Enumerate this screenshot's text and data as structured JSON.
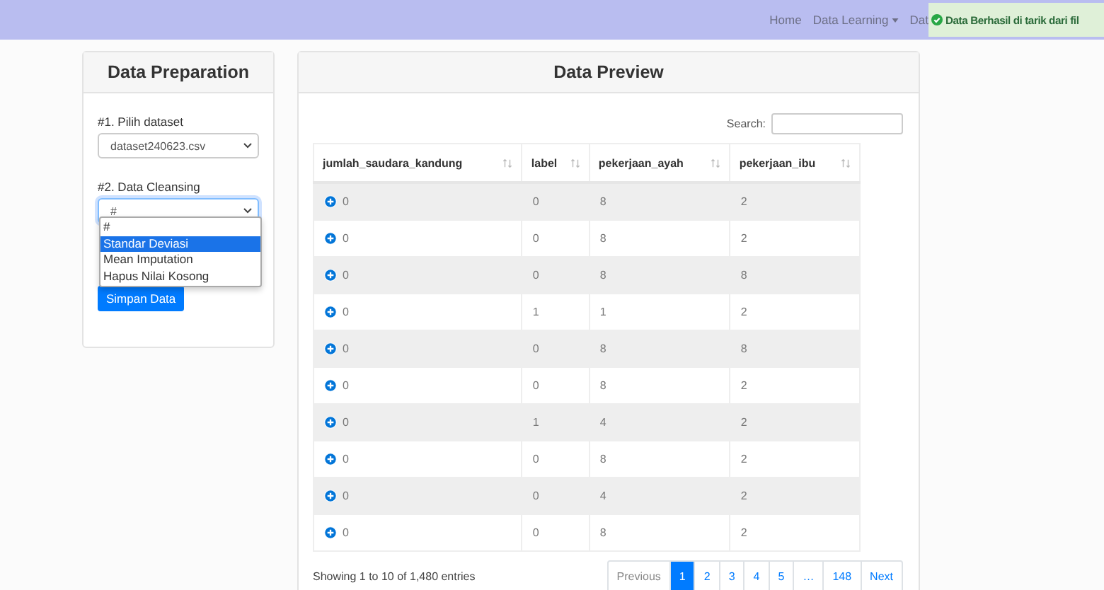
{
  "navbar": {
    "links": [
      {
        "label": "Home",
        "dropdown": false
      },
      {
        "label": "Data Learning",
        "dropdown": true
      },
      {
        "label": "Dat",
        "dropdown": false
      }
    ]
  },
  "toast": {
    "message": "Data Berhasil di tarik dari fil"
  },
  "preparation": {
    "title": "Data Preparation",
    "dataset_label": "#1. Pilih dataset",
    "dataset_value": "dataset240623.csv",
    "cleansing_label": "#2. Data Cleansing",
    "cleansing_value": "#",
    "cleansing_options": [
      {
        "label": "#",
        "selected": false
      },
      {
        "label": "Standar Deviasi",
        "selected": true
      },
      {
        "label": "Mean Imputation",
        "selected": false
      },
      {
        "label": "Hapus Nilai Kosong",
        "selected": false
      }
    ],
    "save_button": "Simpan Data"
  },
  "preview": {
    "title": "Data Preview",
    "search_label": "Search:",
    "table": {
      "columns": [
        "jumlah_saudara_kandung",
        "label",
        "pekerjaan_ayah",
        "pekerjaan_ibu"
      ],
      "rows": [
        [
          "0",
          "0",
          "8",
          "2"
        ],
        [
          "0",
          "0",
          "8",
          "2"
        ],
        [
          "0",
          "0",
          "8",
          "8"
        ],
        [
          "0",
          "1",
          "1",
          "2"
        ],
        [
          "0",
          "0",
          "8",
          "8"
        ],
        [
          "0",
          "0",
          "8",
          "2"
        ],
        [
          "0",
          "1",
          "4",
          "2"
        ],
        [
          "0",
          "0",
          "8",
          "2"
        ],
        [
          "0",
          "0",
          "4",
          "2"
        ],
        [
          "0",
          "0",
          "8",
          "2"
        ]
      ]
    },
    "info": "Showing 1 to 10 of 1,480 entries",
    "pagination": [
      {
        "label": "Previous",
        "selected": false
      },
      {
        "label": "1",
        "selected": true
      },
      {
        "label": "2",
        "selected": false
      },
      {
        "label": "3",
        "selected": false
      },
      {
        "label": "4",
        "selected": false
      },
      {
        "label": "5",
        "selected": false
      },
      {
        "label": "…",
        "selected": false
      },
      {
        "label": "148",
        "selected": false
      },
      {
        "label": "Next",
        "selected": false
      }
    ]
  }
}
